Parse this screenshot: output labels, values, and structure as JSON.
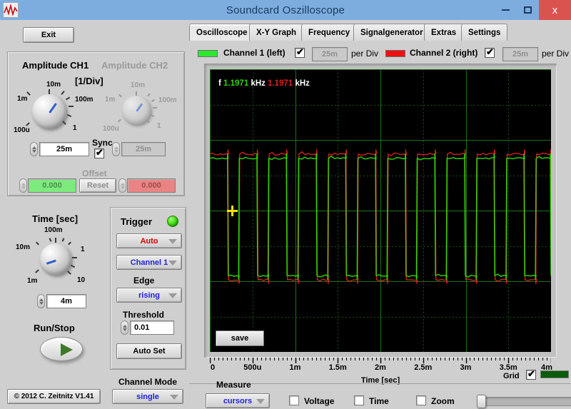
{
  "window": {
    "title": "Soundcard Oszilloscope",
    "minimize_label": "minimize",
    "maximize_label": "maximize",
    "close_label": "x"
  },
  "toolbar": {
    "exit_label": "Exit"
  },
  "tabs": [
    {
      "label": "Oscilloscope",
      "active": true
    },
    {
      "label": "X-Y Graph",
      "active": false
    },
    {
      "label": "Frequency",
      "active": false
    },
    {
      "label": "Signalgenerator",
      "active": false
    },
    {
      "label": "Extras",
      "active": false
    },
    {
      "label": "Settings",
      "active": false
    }
  ],
  "channel_bar": {
    "ch1": {
      "swatch_color": "#2fe62f",
      "label": "Channel 1 (left)",
      "enabled": true,
      "per_div_value": "25m",
      "per_div_label": "per Div"
    },
    "ch2": {
      "swatch_color": "#ee1111",
      "label": "Channel 2 (right)",
      "enabled": true,
      "per_div_value": "25m",
      "per_div_label": "per Div"
    }
  },
  "amplitude_panel": {
    "ch1_title": "Amplitude CH1",
    "ch2_title": "Amplitude CH2",
    "per_div_unit": "[1/Div]",
    "ch1_knob_labels": [
      "1m",
      "10m",
      "100m",
      "1",
      "100u"
    ],
    "ch2_knob_labels": [
      "1m",
      "10m",
      "100m",
      "1",
      "100u"
    ],
    "ch1_value": "25m",
    "ch2_value": "25m",
    "sync_label": "Sync",
    "sync_checked": true,
    "offset_label": "Offset",
    "offset_ch1": "0.000",
    "offset_ch2": "0.000",
    "reset_label": "Reset",
    "ch1_offset_color": "#7dea7d",
    "ch2_offset_color": "#ea8484"
  },
  "time_panel": {
    "title": "Time [sec]",
    "knob_labels": [
      "10m",
      "100m",
      "1",
      "10",
      "1m"
    ],
    "value": "4m",
    "runstop_label": "Run/Stop"
  },
  "trigger_panel": {
    "title": "Trigger",
    "led_color": "#2fd400",
    "mode": "Auto",
    "mode_color": "#e00000",
    "source": "Channel 1",
    "source_color": "#2222dd",
    "edge_label": "Edge",
    "edge": "rising",
    "edge_color": "#2222dd",
    "threshold_label": "Threshold",
    "threshold": "0.01",
    "autoset_label": "Auto Set"
  },
  "channel_mode": {
    "label": "Channel Mode",
    "value": "single",
    "value_color": "#2222dd"
  },
  "measure": {
    "label": "Measure",
    "value": "cursors",
    "value_color": "#2222dd",
    "voltage_label": "Voltage",
    "voltage_checked": false,
    "time_label": "Time",
    "time_checked": false,
    "zoom_label": "Zoom",
    "zoom_checked": false,
    "zoom_slider_value": 0
  },
  "footer": {
    "copyright": "© 2012  C. Zeitnitz V1.41"
  },
  "scope": {
    "freq_prefix": "f",
    "ch1_freq": "1.1971",
    "ch1_unit": "kHz",
    "ch2_freq": "1.1971",
    "ch2_unit": "kHz",
    "save_label": "save",
    "grid_label": "Grid",
    "grid_checked": true,
    "grid_color": "#0b5c0b",
    "x_title": "Time [sec]",
    "cursor_color": "#ffe000",
    "background": "#000000"
  },
  "chart_data": {
    "type": "line",
    "title": "Oscilloscope trace",
    "xlabel": "Time [sec]",
    "ylabel": "",
    "xlim": [
      0,
      0.004
    ],
    "xtick_labels": [
      "0",
      "500u",
      "1m",
      "1.5m",
      "2m",
      "2.5m",
      "3m",
      "3.5m",
      "4m"
    ],
    "xtick_values": [
      0,
      0.0005,
      0.001,
      0.0015,
      0.002,
      0.0025,
      0.003,
      0.0035,
      0.004
    ],
    "ylim": [
      -0.1,
      0.1
    ],
    "grid": true,
    "legend": [
      "Channel 1 (left)",
      "Channel 2 (right)"
    ],
    "series": [
      {
        "name": "Channel 1 (left)",
        "color": "#2fd400",
        "frequency_khz": 1.1971,
        "waveform": "square",
        "high_level": 0.037,
        "low_level": -0.046,
        "edges_us": [
          0,
          215,
          345,
          560,
          690,
          905,
          1040,
          1255,
          1390,
          1600,
          1735,
          1950,
          2085,
          2300,
          2430,
          2645,
          2780,
          2995,
          3130,
          3340,
          3480,
          3690,
          3825,
          4000
        ]
      },
      {
        "name": "Channel 2 (right)",
        "color": "#d02020",
        "frequency_khz": 1.1971,
        "waveform": "square",
        "high_level": 0.04,
        "low_level": -0.049,
        "edges_us": [
          0,
          215,
          345,
          560,
          690,
          905,
          1040,
          1255,
          1390,
          1600,
          1735,
          1950,
          2085,
          2300,
          2430,
          2645,
          2780,
          2995,
          3130,
          3340,
          3480,
          3690,
          3825,
          4000
        ]
      }
    ],
    "cursor": {
      "x_us": 262,
      "y": 0.0
    },
    "grid_divisions_x": 8,
    "grid_divisions_y": 8
  }
}
